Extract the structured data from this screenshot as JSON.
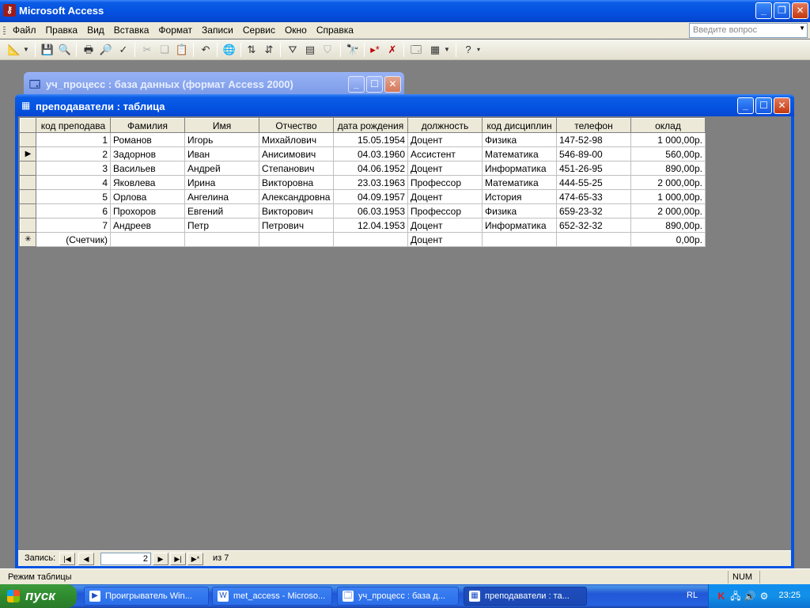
{
  "app": {
    "title": "Microsoft Access"
  },
  "menu": {
    "items": [
      "Файл",
      "Правка",
      "Вид",
      "Вставка",
      "Формат",
      "Записи",
      "Сервис",
      "Окно",
      "Справка"
    ],
    "ask_placeholder": "Введите вопрос"
  },
  "db_window": {
    "title": "уч_процесс : база данных (формат Access 2000)"
  },
  "table_window": {
    "title": "преподаватели : таблица",
    "columns": [
      "код преподава",
      "Фамилия",
      "Имя",
      "Отчество",
      "дата рождения",
      "должность",
      "код дисциплин",
      "телефон",
      "оклад"
    ],
    "rows": [
      [
        "1",
        "Романов",
        "Игорь",
        "Михайлович",
        "15.05.1954",
        "Доцент",
        "Физика",
        "147-52-98",
        "1 000,00р."
      ],
      [
        "2",
        "Задорнов",
        "Иван",
        "Анисимович",
        "04.03.1960",
        "Ассистент",
        "Математика",
        "546-89-00",
        "560,00р."
      ],
      [
        "3",
        "Васильев",
        "Андрей",
        "Степанович",
        "04.06.1952",
        "Доцент",
        "Информатика",
        "451-26-95",
        "890,00р."
      ],
      [
        "4",
        "Яковлева",
        "Ирина",
        "Викторовна",
        "23.03.1963",
        "Профессор",
        "Математика",
        "444-55-25",
        "2 000,00р."
      ],
      [
        "5",
        "Орлова",
        "Ангелина",
        "Александровна",
        "04.09.1957",
        "Доцент",
        "История",
        "474-65-33",
        "1 000,00р."
      ],
      [
        "6",
        "Прохоров",
        "Евгений",
        "Викторович",
        "06.03.1953",
        "Профессор",
        "Физика",
        "659-23-32",
        "2 000,00р."
      ],
      [
        "7",
        "Андреев",
        "Петр",
        "Петрович",
        "12.04.1953",
        "Доцент",
        "Информатика",
        "652-32-32",
        "890,00р."
      ]
    ],
    "new_row": [
      "(Счетчик)",
      "",
      "",
      "",
      "",
      "Доцент",
      "",
      "",
      "0,00р."
    ],
    "current_row_index": 1
  },
  "navigation": {
    "label": "Запись:",
    "current": "2",
    "of_text": "из  7"
  },
  "status": {
    "mode": "Режим таблицы",
    "num": "NUM"
  },
  "taskbar": {
    "start": "пуск",
    "tasks": [
      "Проигрыватель Win...",
      "met_access - Microso...",
      "уч_процесс : база д...",
      "преподаватели : та..."
    ],
    "lang": "RL",
    "clock": "23:25"
  }
}
